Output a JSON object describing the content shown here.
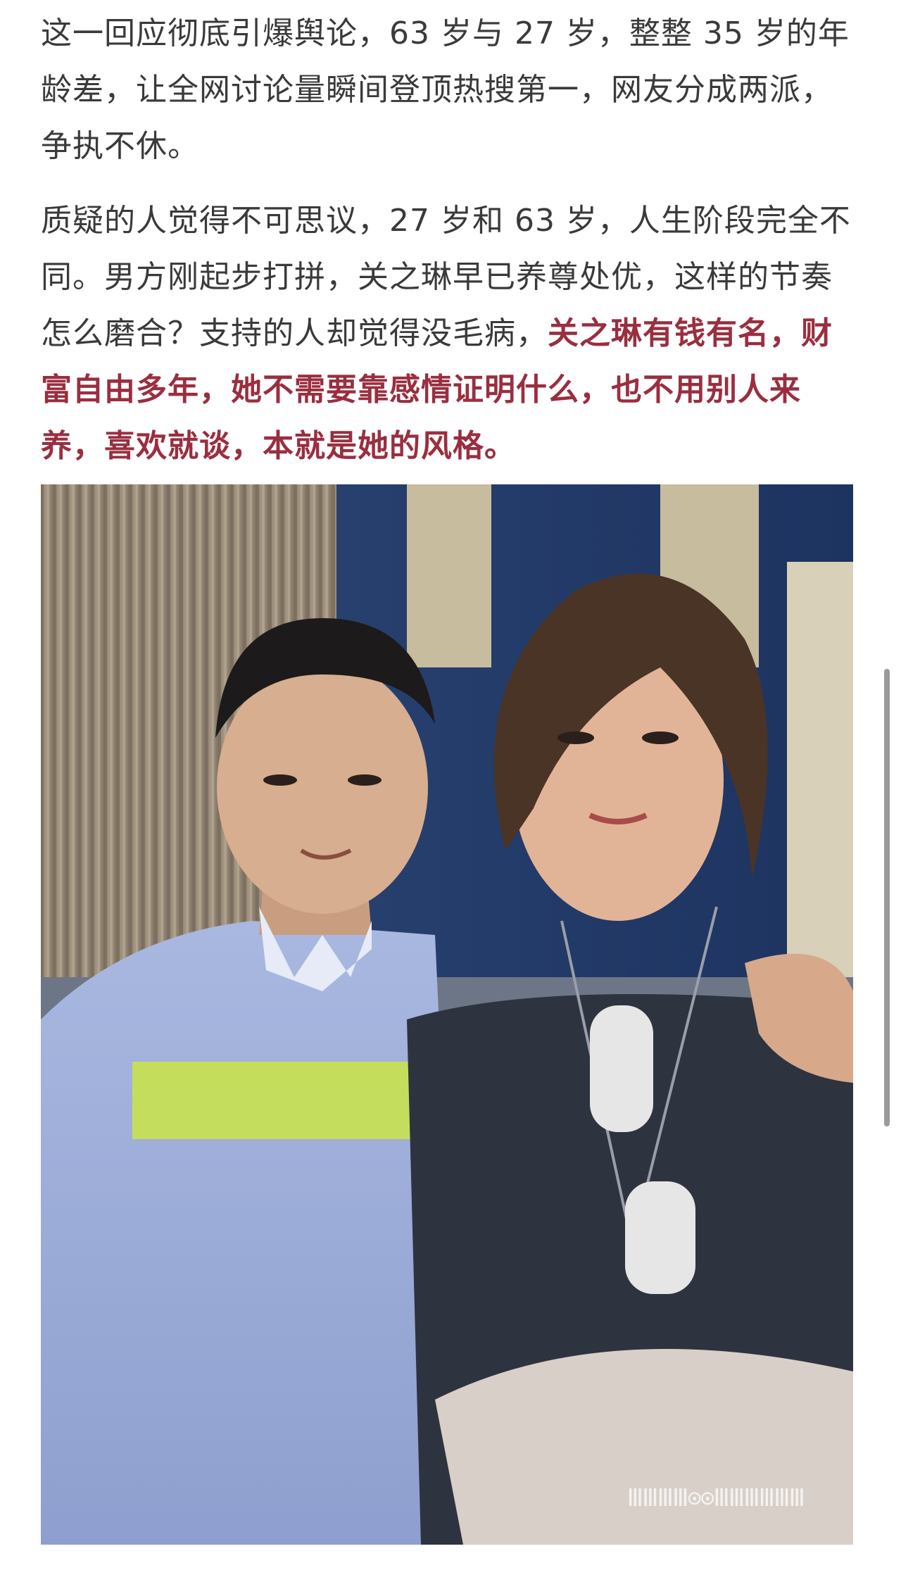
{
  "article": {
    "paragraph1": "这一回应彻底引爆舆论，63 岁与 27 岁，整整 35 岁的年龄差，让全网讨论量瞬间登顶热搜第一，网友分成两派，争执不休。",
    "paragraph2_plain": "质疑的人觉得不可思议，27 岁和 63 岁，人生阶段完全不同。男方刚起步打拼，关之琳早已养尊处优，这样的节奏怎么磨合？支持的人却觉得没毛病，",
    "paragraph2_highlight": "关之琳有钱有名，财富自由多年，她不需要靠感情证明什么，也不用别人来养，喜欢就谈，本就是她的风格。"
  },
  "colors": {
    "text": "#3a3a3a",
    "highlight": "#9a2e3f",
    "background": "#ffffff"
  },
  "image": {
    "watermark": "ⅢⅢⅢⅢ⊙⊙ⅢⅢⅢⅢⅢⅢ"
  }
}
